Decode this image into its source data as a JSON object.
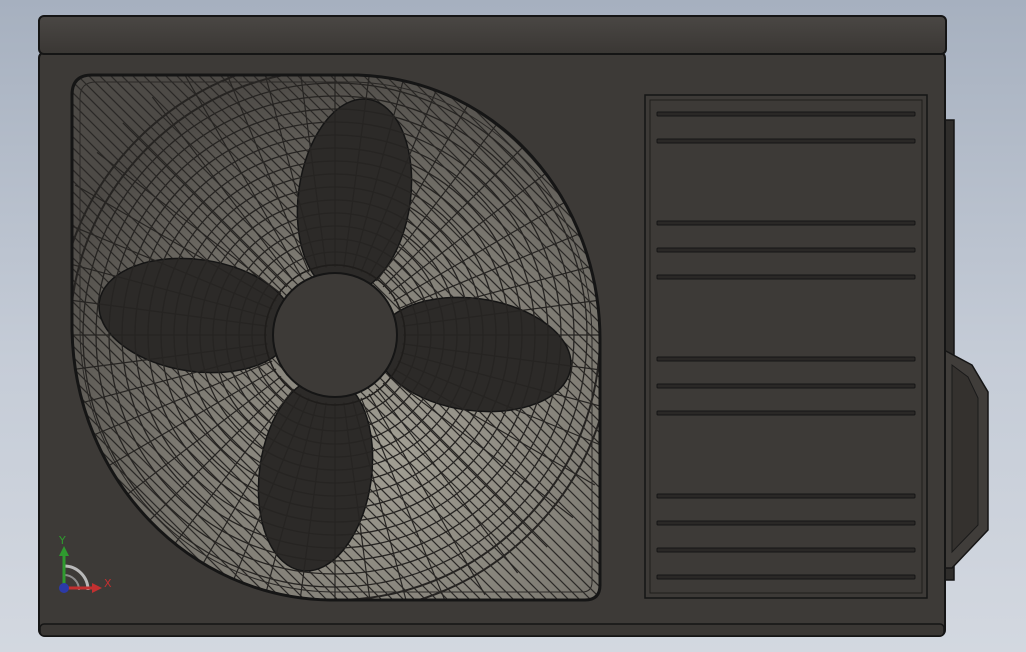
{
  "viewport": {
    "background_top": "#a6b0bf",
    "background_bottom": "#d3d8e0"
  },
  "model": {
    "object": "outdoor-ac-unit",
    "body_color": "#3d3a37",
    "edge_color": "#151515",
    "fan_blade_count": 4,
    "right_panel_slot_groups": [
      2,
      3,
      3,
      4
    ]
  },
  "triad": {
    "x_label": "X",
    "y_label": "Y",
    "x_color": "#c23030",
    "y_color": "#2f9a2f",
    "z_color": "#2c3aa8"
  }
}
